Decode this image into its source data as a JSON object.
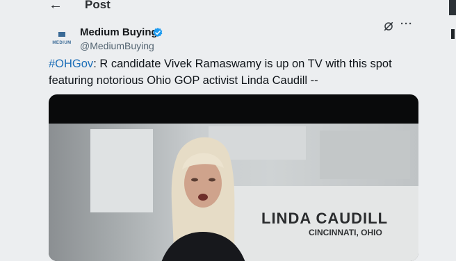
{
  "header": {
    "back_glyph": "←",
    "title": "Post"
  },
  "post": {
    "author": {
      "name": "Medium Buying",
      "handle": "@MediumBuying",
      "avatar_text": "MEDIUM",
      "verified": true
    },
    "actions": {
      "grok_icon": "slash-circle-icon",
      "more_glyph": "···"
    },
    "text": {
      "hashtag": "#OHGov",
      "body": ": R candidate Vivek Ramaswamy is up on TV with this spot featuring notorious Ohio GOP activist Linda Caudill --"
    },
    "video": {
      "lower_third_name": "LINDA CAUDILL",
      "lower_third_location": "CINCINNATI, OHIO"
    }
  },
  "colors": {
    "accent": "#1d6fb8",
    "verified": "#1d9bf0",
    "background": "#eceef0"
  }
}
